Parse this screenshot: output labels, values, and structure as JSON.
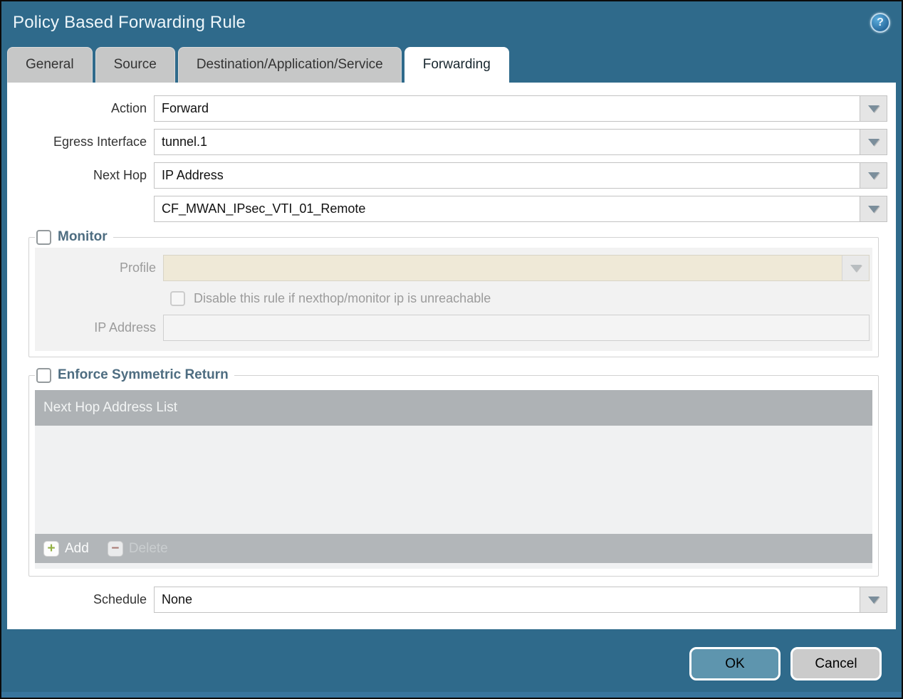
{
  "dialog": {
    "title": "Policy Based Forwarding Rule"
  },
  "icons": {
    "help_glyph": "?",
    "add_glyph": "+",
    "delete_glyph": "−"
  },
  "tabs": [
    {
      "label": "General",
      "active": false
    },
    {
      "label": "Source",
      "active": false
    },
    {
      "label": "Destination/Application/Service",
      "active": false
    },
    {
      "label": "Forwarding",
      "active": true
    }
  ],
  "form": {
    "action": {
      "label": "Action",
      "value": "Forward"
    },
    "egress_interface": {
      "label": "Egress Interface",
      "value": "tunnel.1"
    },
    "next_hop": {
      "label": "Next Hop",
      "value": "IP Address"
    },
    "next_hop_address": {
      "value": "CF_MWAN_IPsec_VTI_01_Remote"
    },
    "schedule": {
      "label": "Schedule",
      "value": "None"
    }
  },
  "monitor": {
    "legend": "Monitor",
    "checked": false,
    "profile_label": "Profile",
    "profile_value": "",
    "disable_rule_label": "Disable this rule if nexthop/monitor ip is unreachable",
    "disable_rule_checked": false,
    "ip_address_label": "IP Address",
    "ip_address_value": ""
  },
  "enforce_symmetric_return": {
    "legend": "Enforce Symmetric Return",
    "checked": false,
    "table": {
      "header": "Next Hop Address List",
      "rows": [],
      "add_label": "Add",
      "delete_label": "Delete"
    }
  },
  "footer": {
    "ok_label": "OK",
    "cancel_label": "Cancel"
  },
  "colors": {
    "frame_teal": "#2f6a8b",
    "accent_strip": "#38759d",
    "legend_text": "#4e6d81",
    "grid_header_bg": "#aeb2b5",
    "disabled_field_bg": "#efe9d7",
    "ok_button_bg": "#5e95ae",
    "cancel_button_bg": "#cbcbcb"
  }
}
